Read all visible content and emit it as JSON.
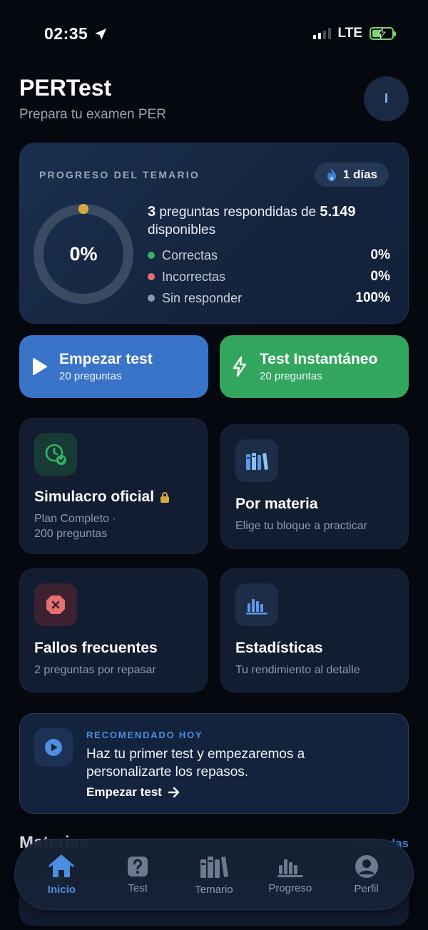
{
  "status_bar": {
    "time": "02:35",
    "network": "LTE"
  },
  "header": {
    "title": "PERTest",
    "subtitle": "Prepara tu examen PER",
    "avatar_initial": "I"
  },
  "progress": {
    "label": "PROGRESO DEL TEMARIO",
    "streak": "1 días",
    "percent_text": "0%",
    "answered_count": "3",
    "answered_middle": " preguntas respondidas de ",
    "available_count": "5.149",
    "available_suffix": "disponibles",
    "legend": [
      {
        "label": "Correctas",
        "value": "0%",
        "color": "#34b365"
      },
      {
        "label": "Incorrectas",
        "value": "0%",
        "color": "#e66f6f"
      },
      {
        "label": "Sin responder",
        "value": "100%",
        "color": "#8e98aa"
      }
    ],
    "ring_fraction": 0.0
  },
  "actions": {
    "start": {
      "title": "Empezar test",
      "sub": "20 preguntas"
    },
    "instant": {
      "title": "Test Instantáneo",
      "sub": "20 preguntas"
    }
  },
  "features": {
    "simulacro": {
      "title": "Simulacro oficial",
      "sub_line1": "Plan Completo ·",
      "sub_line2": "200 preguntas"
    },
    "materia": {
      "title": "Por materia",
      "sub": "Elige tu bloque a practicar"
    },
    "fallos": {
      "title": "Fallos frecuentes",
      "sub": "2 preguntas por repasar"
    },
    "estadisticas": {
      "title": "Estadísticas",
      "sub": "Tu rendimiento al detalle"
    }
  },
  "recommended": {
    "label": "RECOMENDADO HOY",
    "text": "Haz tu primer test y empezaremos a personalizarte los repasos.",
    "link": "Empezar test"
  },
  "section": {
    "title": "Materias",
    "link": "Ver todas"
  },
  "tabs": [
    {
      "label": "Inicio",
      "icon": "home-icon"
    },
    {
      "label": "Test",
      "icon": "question-icon"
    },
    {
      "label": "Temario",
      "icon": "books-icon"
    },
    {
      "label": "Progreso",
      "icon": "chart-icon"
    },
    {
      "label": "Perfil",
      "icon": "profile-icon"
    }
  ],
  "colors": {
    "accent": "#3a74c9",
    "success": "#33a65e",
    "card": "#131d31",
    "warning": "#d6a840"
  }
}
